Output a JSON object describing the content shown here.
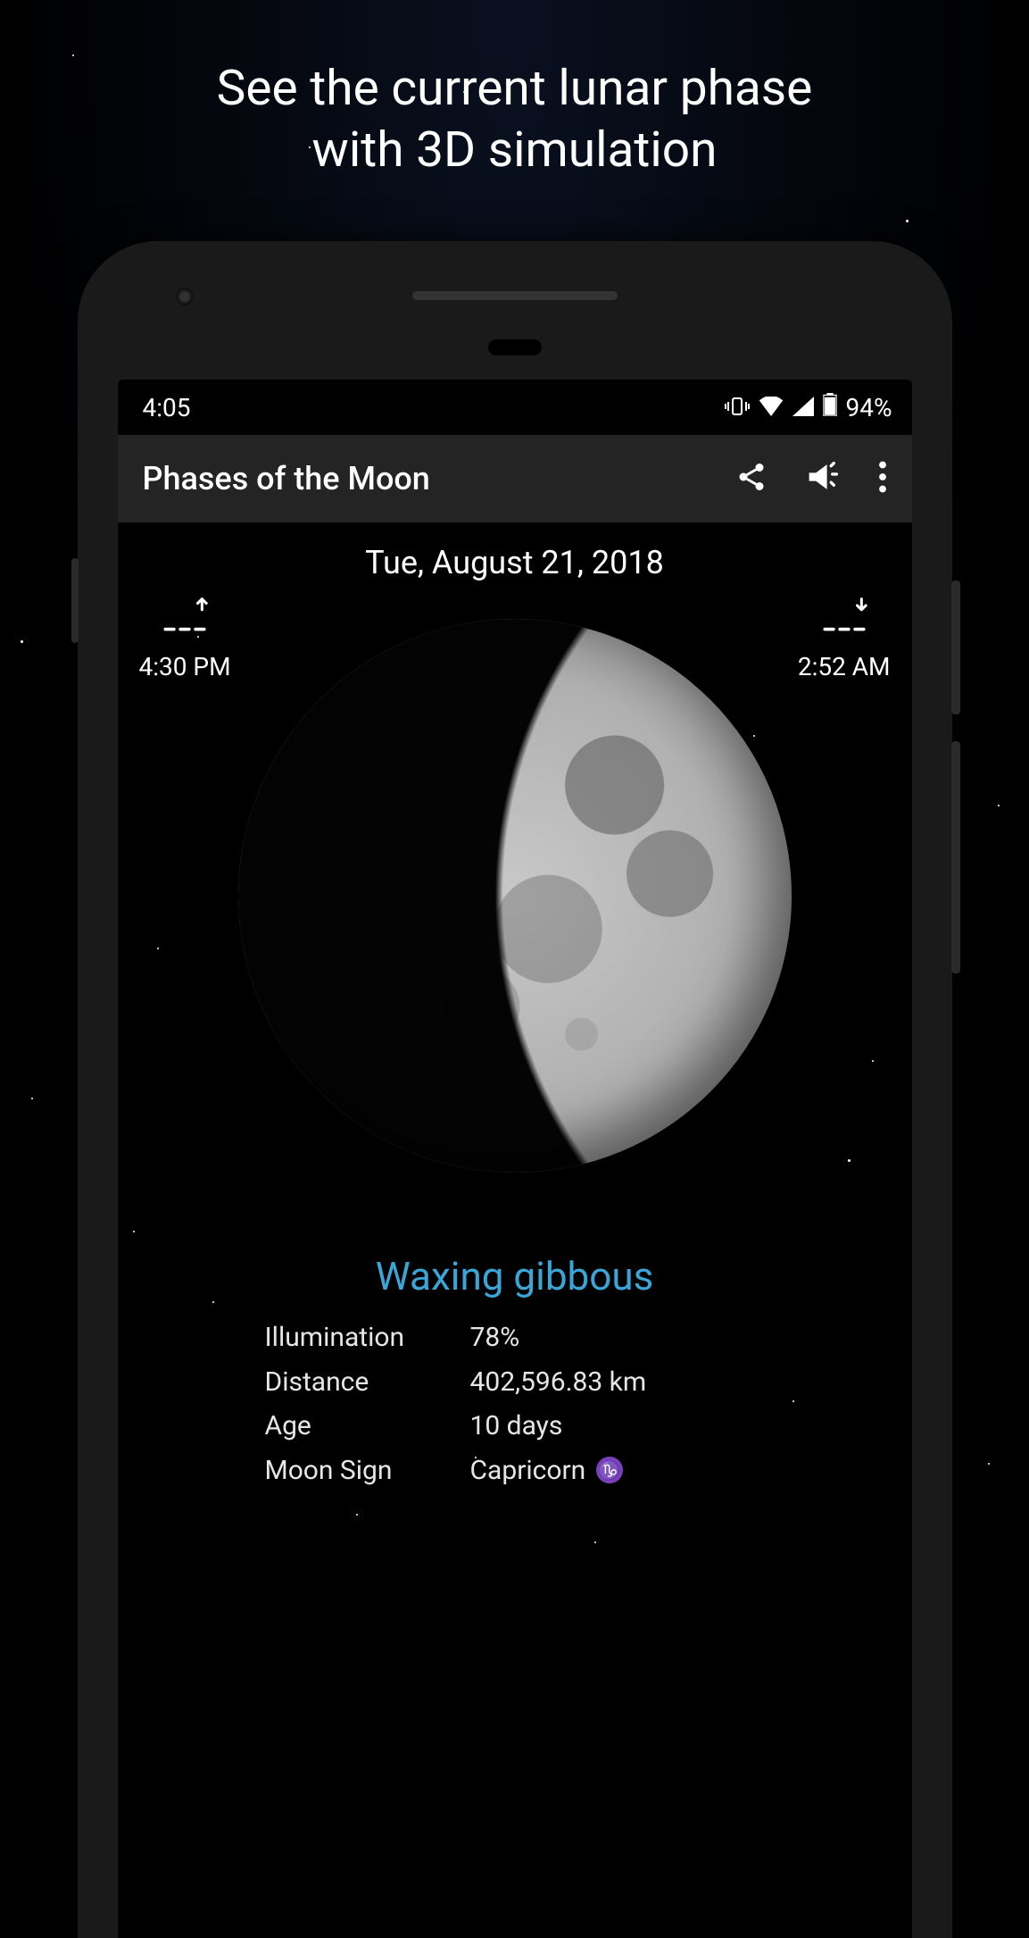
{
  "promo": {
    "line1": "See the current lunar phase",
    "line2": "with 3D simulation"
  },
  "status": {
    "time": "4:05",
    "battery_pct": "94%"
  },
  "app_bar": {
    "title": "Phases of the Moon"
  },
  "main": {
    "date": "Tue, August 21, 2018",
    "moonrise_time": "4:30 PM",
    "moonset_time": "2:52 AM",
    "phase_name": "Waxing gibbous",
    "stats": {
      "illumination_label": "Illumination",
      "illumination_value": "78%",
      "distance_label": "Distance",
      "distance_value": "402,596.83 km",
      "age_label": "Age",
      "age_value": "10 days",
      "moon_sign_label": "Moon Sign",
      "moon_sign_value": "Capricorn",
      "moon_sign_glyph": "♑"
    }
  }
}
